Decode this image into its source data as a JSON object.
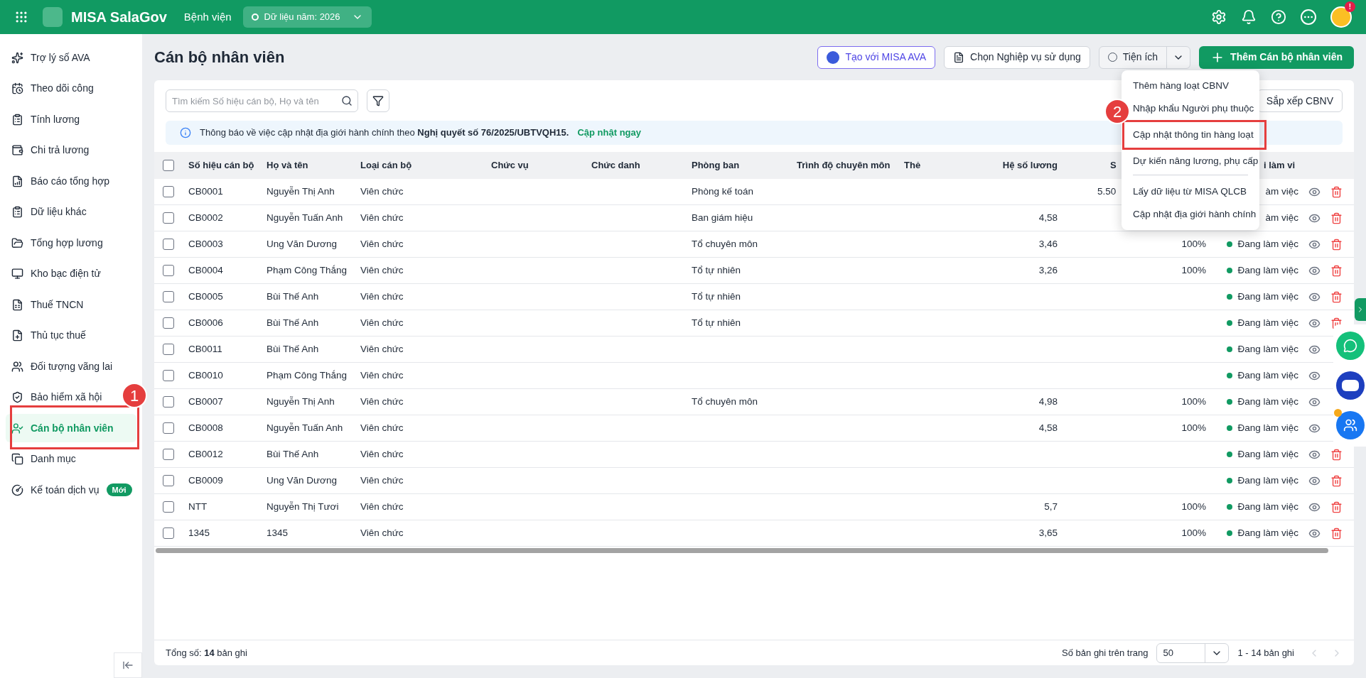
{
  "header": {
    "app_name": "MISA SalaGov",
    "unit": "Bệnh viện",
    "data_year": "Dữ liệu năm: 2026",
    "notification_badge": "!"
  },
  "sidebar": {
    "items": [
      {
        "label": "Trợ lý số AVA",
        "selected": false
      },
      {
        "label": "Theo dõi công",
        "selected": false
      },
      {
        "label": "Tính lương",
        "selected": false
      },
      {
        "label": "Chi trả lương",
        "selected": false
      },
      {
        "label": "Báo cáo tổng hợp",
        "selected": false
      },
      {
        "label": "Dữ liệu khác",
        "selected": false
      },
      {
        "label": "Tổng hợp lương",
        "selected": false
      },
      {
        "label": "Kho bạc điện tử",
        "selected": false
      },
      {
        "label": "Thuế TNCN",
        "selected": false
      },
      {
        "label": "Thủ tục thuế",
        "selected": false
      },
      {
        "label": "Đối tượng vãng lai",
        "selected": false
      },
      {
        "label": "Bảo hiểm xã hội",
        "selected": false
      },
      {
        "label": "Cán bộ nhân viên",
        "selected": true,
        "callout": "1"
      },
      {
        "label": "Danh mục",
        "selected": false
      },
      {
        "label": "Kế toán dịch vụ",
        "selected": false,
        "badge": "Mới"
      }
    ]
  },
  "page": {
    "title": "Cán bộ nhân viên",
    "actions": {
      "ava": "Tạo với MISA AVA",
      "choose": "Chọn Nghiệp vụ sử dụng",
      "utilities": "Tiện ích",
      "add": "Thêm Cán bộ nhân viên"
    },
    "utilities_menu": [
      [
        {
          "label": "Thêm hàng loạt CBNV"
        },
        {
          "label": "Nhập khẩu Người phụ thuộc"
        },
        {
          "label": "Cập nhật thông tin hàng loạt",
          "callout": "2"
        },
        {
          "label": "Dự kiến nâng lương, phụ cấp"
        }
      ],
      [
        {
          "label": "Lấy dữ liệu từ MISA QLCB"
        },
        {
          "label": "Cập nhật địa giới hành chính"
        }
      ]
    ],
    "search": {
      "placeholder": "Tìm kiếm Số hiệu cán bộ, Họ và tên"
    },
    "sort_button": "Sắp xếp CBNV",
    "notice": {
      "text": "Thông báo về việc cập nhật địa giới hành chính theo **Nghị quyết số 76/2025/UBTVQH15.**",
      "link": "Cập nhật ngay"
    }
  },
  "table": {
    "select_all_checked": false,
    "columns": [
      "Số hiệu cán bộ",
      "Họ và tên",
      "Loại cán bộ",
      "Chức vụ",
      "Chức danh",
      "Phòng ban",
      "Trình độ chuyên môn",
      "Thẻ",
      "Hệ số lương",
      "S",
      "i làm vi"
    ],
    "rows": [
      {
        "code": "CB0001",
        "name": "Nguyễn Thị Anh",
        "type": "Viên chức",
        "department": "Phòng kế toán",
        "column_10": "5.50",
        "status": "àm việc",
        "dot": false,
        "checked": false
      },
      {
        "code": "CB0002",
        "name": "Nguyễn Tuấn Anh",
        "type": "Viên chức",
        "department": "Ban giám hiệu",
        "salary": "4,58",
        "status": "àm việc",
        "dot": false,
        "checked": false
      },
      {
        "code": "CB0003",
        "name": "Ung Văn Dương",
        "type": "Viên chức",
        "department": "Tổ chuyên môn",
        "salary": "3,46",
        "column_10": "100%",
        "status": "Đang làm việc",
        "dot": true,
        "checked": false
      },
      {
        "code": "CB0004",
        "name": "Phạm Công Thắng",
        "type": "Viên chức",
        "department": "Tổ tự nhiên",
        "salary": "3,26",
        "column_10": "100%",
        "status": "Đang làm việc",
        "dot": true,
        "checked": false
      },
      {
        "code": "CB0005",
        "name": "Bùi Thế Anh",
        "type": "Viên chức",
        "department": "Tổ tự nhiên",
        "status": "Đang làm việc",
        "dot": true,
        "checked": false
      },
      {
        "code": "CB0006",
        "name": "Bùi Thế Anh",
        "type": "Viên chức",
        "department": "Tổ tự nhiên",
        "status": "Đang làm việc",
        "dot": true,
        "checked": false
      },
      {
        "code": "CB0011",
        "name": "Bùi Thế Anh",
        "type": "Viên chức",
        "status": "Đang làm việc",
        "dot": true,
        "checked": false
      },
      {
        "code": "CB0010",
        "name": "Phạm Công Thắng",
        "type": "Viên chức",
        "status": "Đang làm việc",
        "dot": true,
        "checked": false
      },
      {
        "code": "CB0007",
        "name": "Nguyễn Thị Anh",
        "type": "Viên chức",
        "department": "Tổ chuyên môn",
        "salary": "4,98",
        "column_10": "100%",
        "status": "Đang làm việc",
        "dot": true,
        "checked": false
      },
      {
        "code": "CB0008",
        "name": "Nguyễn Tuấn Anh",
        "type": "Viên chức",
        "salary": "4,58",
        "column_10": "100%",
        "status": "Đang làm việc",
        "dot": true,
        "checked": false
      },
      {
        "code": "CB0012",
        "name": "Bùi Thế Anh",
        "type": "Viên chức",
        "status": "Đang làm việc",
        "dot": true,
        "checked": false
      },
      {
        "code": "CB0009",
        "name": "Ung Văn Dương",
        "type": "Viên chức",
        "status": "Đang làm việc",
        "dot": true,
        "checked": false
      },
      {
        "code": "NTT",
        "name": "Nguyễn Thị Tươi",
        "type": "Viên chức",
        "salary": "5,7",
        "column_10": "100%",
        "status": "Đang làm việc",
        "dot": true,
        "checked": false
      },
      {
        "code": "1345",
        "name": "1345",
        "type": "Viên chức",
        "salary": "3,65",
        "column_10": "100%",
        "status": "Đang làm việc",
        "dot": true,
        "checked": false
      }
    ]
  },
  "footer": {
    "total": "Tổng số: **14** bản ghi",
    "page_size_label": "Số bản ghi trên trang",
    "page_size": "50",
    "range": "1 - 14 bản ghi"
  }
}
